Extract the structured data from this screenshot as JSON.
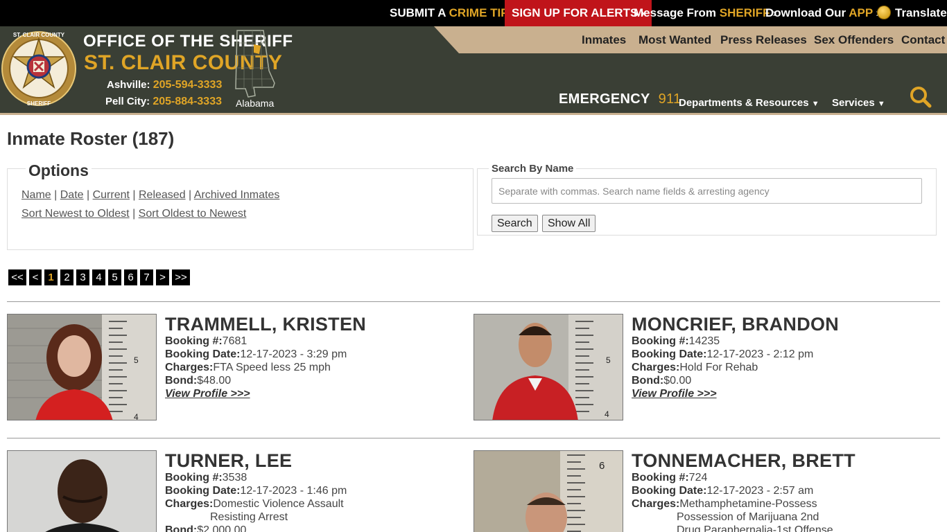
{
  "topbar": {
    "crime_tip_a": "SUBMIT A",
    "crime_tip_b": "CRIME TIP",
    "alerts": "SIGN UP FOR ALERTS",
    "message_a": "Message From",
    "message_b": "SHERIFF",
    "download_a": "Download Our",
    "download_b": "APP",
    "translate": "Translate"
  },
  "header": {
    "line1": "OFFICE OF THE SHERIFF",
    "line2": "ST. CLAIR COUNTY",
    "phone1_label": "Ashville:",
    "phone1_num": "205-594-3333",
    "phone2_label": "Pell City:",
    "phone2_num": "205-884-3333",
    "state": "Alabama",
    "emergency_label": "EMERGENCY",
    "emergency_num": "911",
    "badge_text_top": "ST. CLAIR COUNTY",
    "badge_text_bottom": "SHERIFF"
  },
  "nav": {
    "items": [
      "Inmates",
      "Most Wanted",
      "Press Releases",
      "Sex Offenders",
      "Contact"
    ],
    "departments": "Departments & Resources",
    "services": "Services"
  },
  "page": {
    "title": "Inmate Roster (187)"
  },
  "options": {
    "legend": "Options",
    "row1": [
      "Name",
      "Date",
      "Current",
      "Released",
      "Archived Inmates"
    ],
    "row2": [
      "Sort Newest to Oldest",
      "Sort Oldest to Newest"
    ]
  },
  "search": {
    "legend": "Search By Name",
    "placeholder": "Separate with commas. Search name fields & arresting agency",
    "search_btn": "Search",
    "show_all_btn": "Show All"
  },
  "pager": {
    "first": "<<",
    "prev": "<",
    "pages": [
      "1",
      "2",
      "3",
      "4",
      "5",
      "6",
      "7"
    ],
    "current": "1",
    "next": ">",
    "last": ">>"
  },
  "labels": {
    "booking_no": "Booking #:",
    "booking_date": "Booking Date:",
    "charges": "Charges:",
    "bond": "Bond:",
    "view_profile": "View Profile >>>"
  },
  "inmates": [
    {
      "name": "TRAMMELL, KRISTEN",
      "booking_no": "7681",
      "booking_date": "12-17-2023 - 3:29 pm",
      "charges": [
        "FTA Speed less 25 mph"
      ],
      "bond": "$48.00",
      "show_profile": true
    },
    {
      "name": "MONCRIEF, BRANDON",
      "booking_no": "14235",
      "booking_date": "12-17-2023 - 2:12 pm",
      "charges": [
        "Hold For Rehab"
      ],
      "bond": "$0.00",
      "show_profile": true
    },
    {
      "name": "TURNER, LEE",
      "booking_no": "3538",
      "booking_date": "12-17-2023 - 1:46 pm",
      "charges": [
        "Domestic Violence Assault",
        "Resisting Arrest"
      ],
      "bond": "$2,000.00",
      "show_profile": false
    },
    {
      "name": "TONNEMACHER, BRETT",
      "booking_no": "724",
      "booking_date": "12-17-2023 - 2:57 am",
      "charges": [
        "Methamphetamine-Possess",
        "Possession of Marijuana 2nd",
        "Drug Paraphernalia-1st Offense"
      ],
      "bond": "",
      "show_profile": false
    }
  ],
  "mug_marks": [
    "5",
    "4",
    "5",
    "4",
    "6"
  ],
  "colors": {
    "header_bg": "#3a3f35",
    "nav_tab": "#c9b08f",
    "gold": "#e0a526",
    "alerts_red": "#c0141a"
  }
}
